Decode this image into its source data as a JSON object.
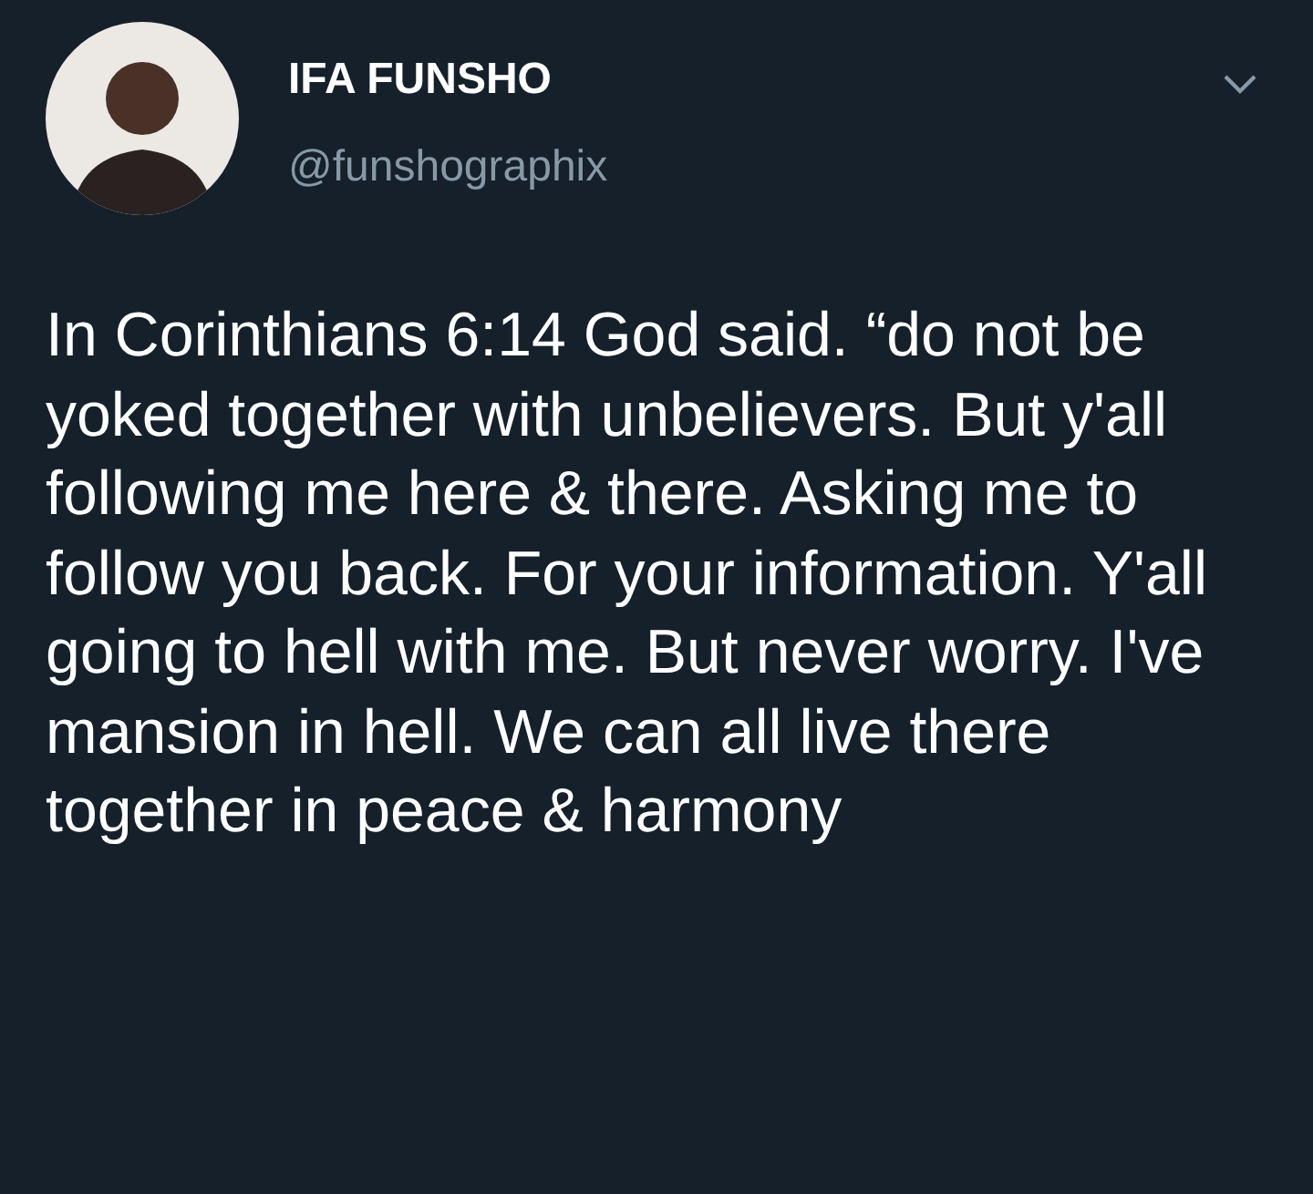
{
  "author": {
    "name": "IFA FUNSHO",
    "handle": "@funshographix"
  },
  "tweet": {
    "text": "In Corinthians 6:14 God said. “do not be yoked together with unbelievers. But y'all following me here & there. Asking me to follow you back. For your information. Y'all going to hell with me. But never worry. I've mansion in hell. We can all live there together in peace & harmony"
  }
}
